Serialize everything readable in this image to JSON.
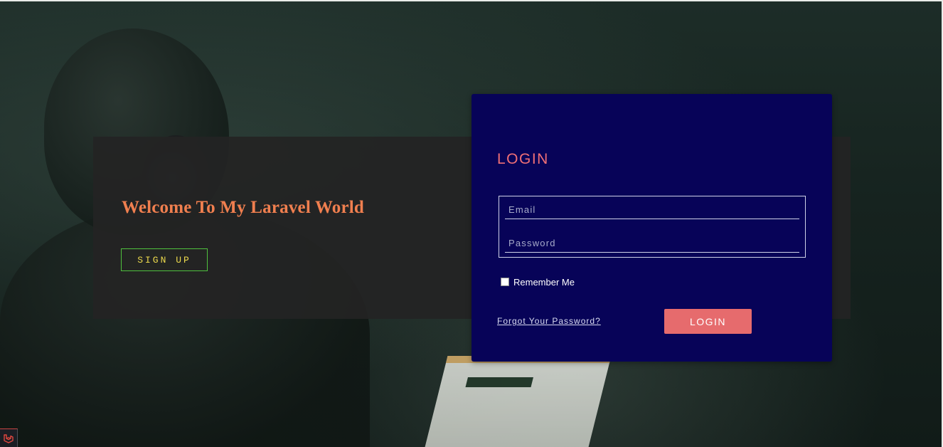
{
  "welcome": {
    "title": "Welcome To My Laravel World",
    "signup_label": "SIGN UP"
  },
  "login": {
    "title": "LOGIN",
    "email_placeholder": "Email",
    "password_placeholder": "Password",
    "remember_label": "Remember Me",
    "forgot_label": "Forgot Your Password?",
    "submit_label": "LOGIN"
  },
  "colors": {
    "card_background": "#070358",
    "accent_coral": "#e66b6d",
    "welcome_title": "#f07f4f",
    "signup_border": "#4fc13e",
    "signup_text": "#ecd94d"
  },
  "icons": {
    "corner_logo": "laravel-icon"
  }
}
